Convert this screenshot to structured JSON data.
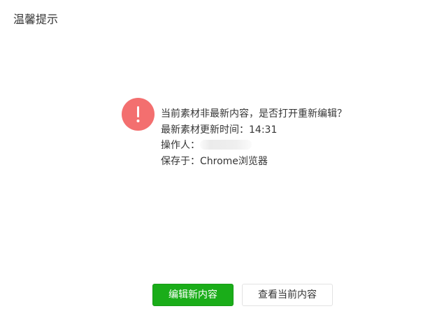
{
  "dialog": {
    "title": "温馨提示"
  },
  "alert": {
    "icon": "exclamation-icon",
    "icon_color": "#f36f6f"
  },
  "message": {
    "line1": "当前素材非最新内容，是否打开重新编辑？",
    "line2_label": "最新素材更新时间：",
    "update_time": "14:31",
    "line3_label": "操作人：",
    "operator": "",
    "line4_label": "保存于：",
    "saved_in": "Chrome浏览器"
  },
  "buttons": {
    "edit_new_label": "编辑新内容",
    "view_current_label": "查看当前内容",
    "primary_color": "#1aad19"
  }
}
